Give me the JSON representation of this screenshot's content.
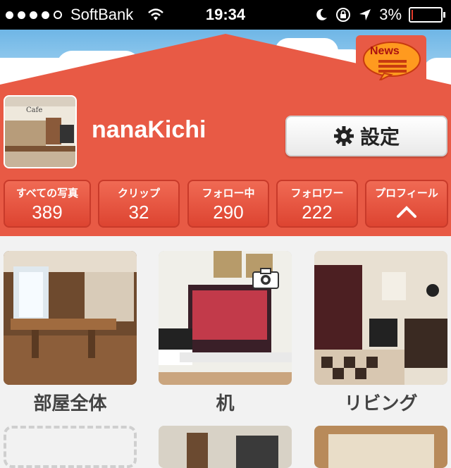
{
  "status_bar": {
    "carrier": "SoftBank",
    "time": "19:34",
    "battery_text": "3%",
    "battery_level": 0.03,
    "signal_bars_filled": 4,
    "signal_bars_total": 5
  },
  "header": {
    "news_label": "News",
    "username": "nanaKichi",
    "settings_label": "設定"
  },
  "stats": [
    {
      "label": "すべての写真",
      "value": "389"
    },
    {
      "label": "クリップ",
      "value": "32"
    },
    {
      "label": "フォロー中",
      "value": "290"
    },
    {
      "label": "フォロワー",
      "value": "222"
    },
    {
      "label": "プロフィール",
      "value": ""
    }
  ],
  "avatar_sign_text": "Cafe",
  "albums": [
    {
      "caption": "部屋全体"
    },
    {
      "caption": "机"
    },
    {
      "caption": "リビング"
    }
  ],
  "colors": {
    "house_red": "#e85a45",
    "sky_blue": "#6fb6e6",
    "battery_red": "#e53b2b"
  },
  "icons": [
    "wifi-icon",
    "moon-icon",
    "rotation-lock-icon",
    "location-arrow-icon",
    "battery-icon",
    "news-icon",
    "gear-icon",
    "chevron-up-icon",
    "camera-icon"
  ]
}
